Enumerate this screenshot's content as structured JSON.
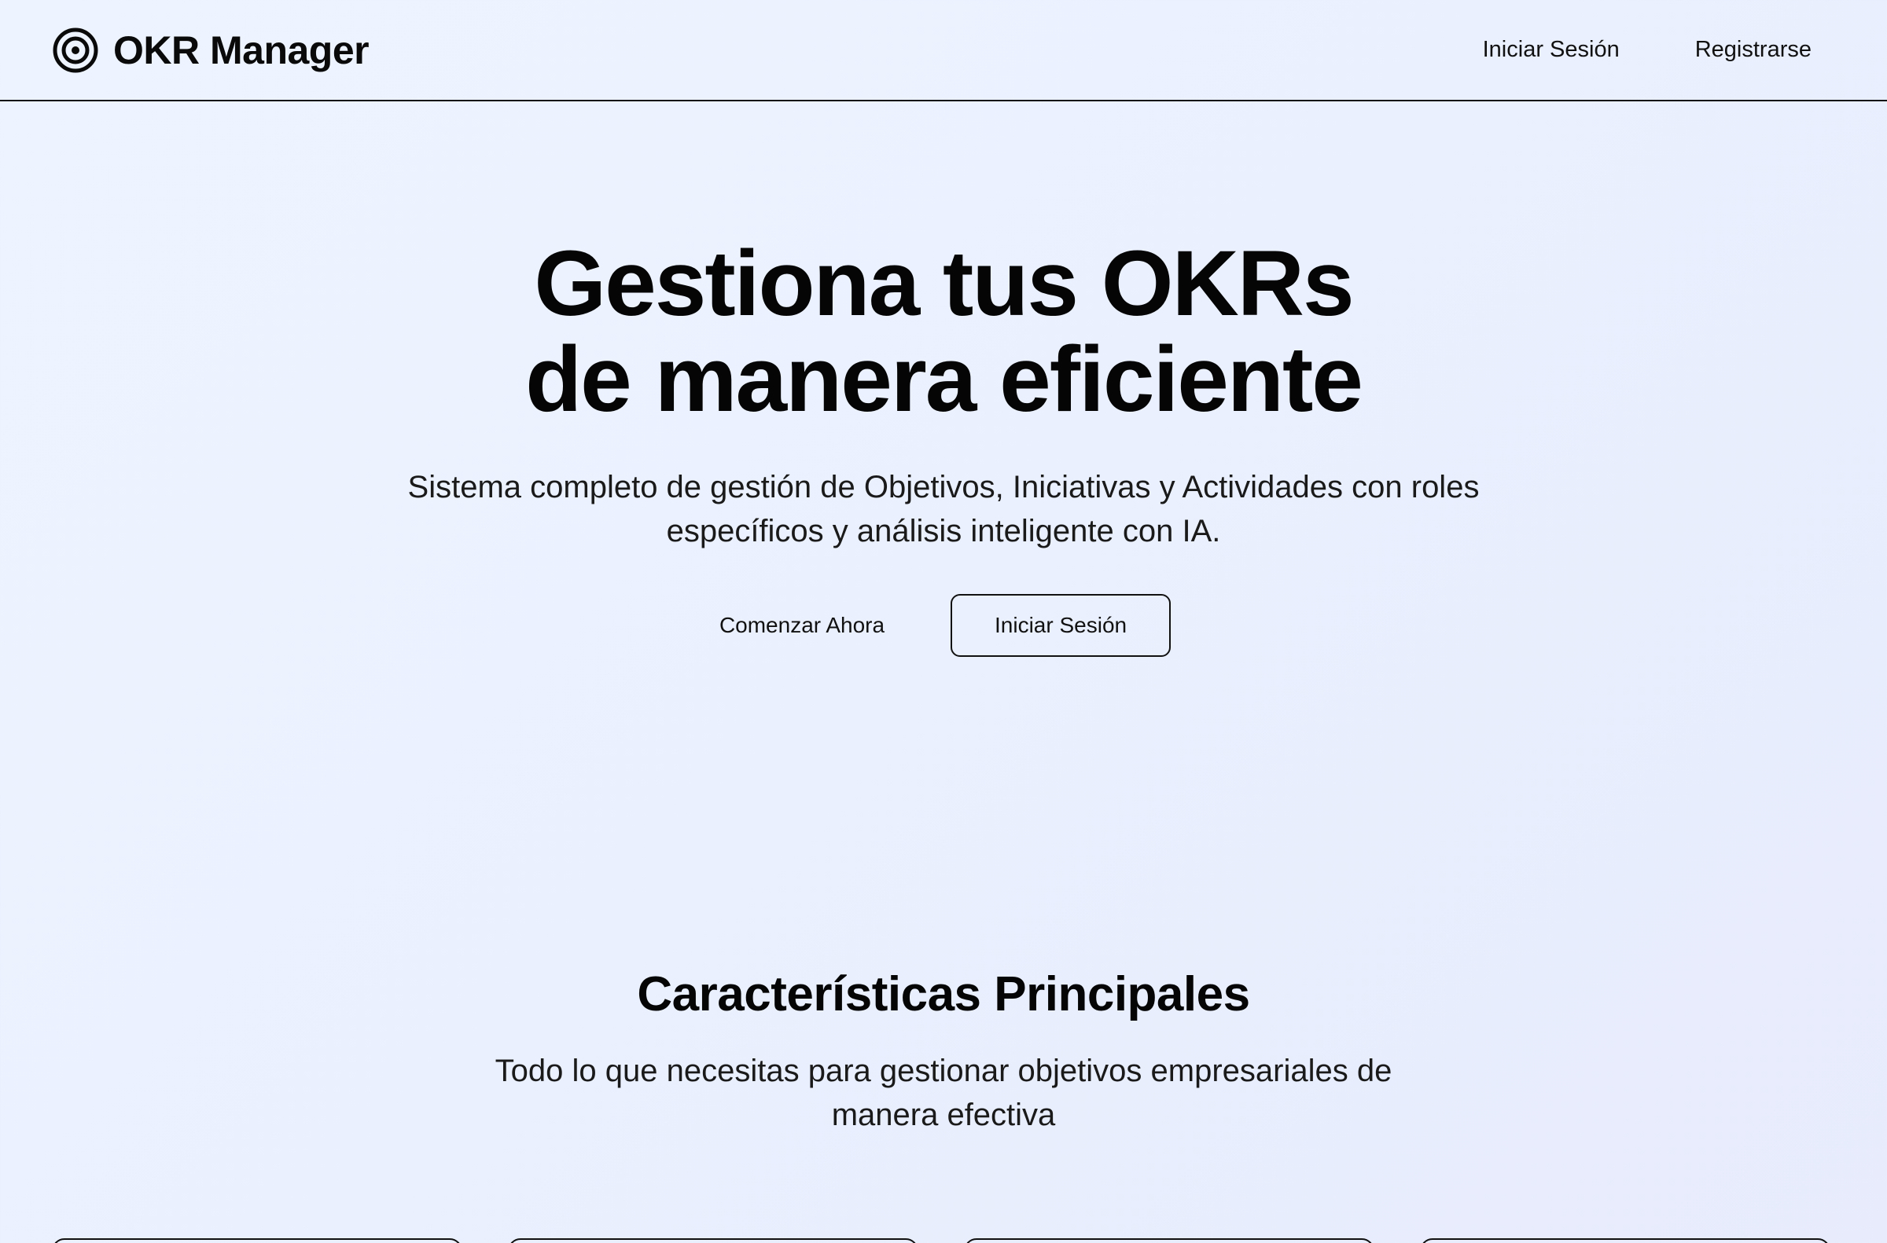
{
  "header": {
    "brand_name": "OKR Manager",
    "brand_icon": "target-icon",
    "nav": {
      "login_label": "Iniciar Sesión",
      "register_label": "Registrarse"
    }
  },
  "hero": {
    "title_line1": "Gestiona tus OKRs",
    "title_line2": "de manera eficiente",
    "subtitle": "Sistema completo de gestión de Objetivos, Iniciativas y Actividades con roles específicos y análisis inteligente con IA.",
    "primary_action": "Comenzar Ahora",
    "secondary_action": "Iniciar Sesión"
  },
  "features": {
    "title": "Características Principales",
    "subtitle": "Todo lo que necesitas para gestionar objetivos empresariales de manera efectiva"
  },
  "colors": {
    "text": "#0a0a0a",
    "background_start": "#eef4ff",
    "background_end": "#e7ebfc",
    "border": "#111111"
  }
}
